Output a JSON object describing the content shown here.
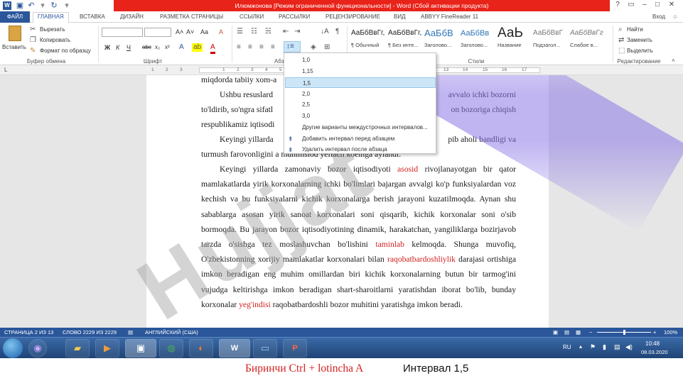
{
  "window": {
    "title": "Илюмжонова [Режим ограниченной функциональности] - Word (Сбой активации продукта)",
    "help": "?",
    "signin": "Вход"
  },
  "tabs": [
    "ФАЙЛ",
    "ГЛАВНАЯ",
    "ВСТАВКА",
    "ДИЗАЙН",
    "РАЗМЕТКА СТРАНИЦЫ",
    "ССЫЛКИ",
    "РАССЫЛКИ",
    "РЕЦЕНЗИРОВАНИЕ",
    "ВИД",
    "ABBYY FineReader 11"
  ],
  "ribbon": {
    "clipboard": {
      "paste": "Вставить",
      "cut": "Вырезать",
      "copy": "Копировать",
      "format_painter": "Формат по образцу",
      "label": "Буфер обмена"
    },
    "font": {
      "label": "Шрифт",
      "bold": "Ж",
      "italic": "К",
      "underline": "Ч",
      "strike": "abc",
      "sub": "x₂",
      "sup": "x²",
      "grow": "A˄",
      "shrink": "A˅",
      "case": "Aa",
      "clear": "A"
    },
    "paragraph": {
      "label": "Абзац"
    },
    "styles": {
      "label": "Стили",
      "items": [
        {
          "preview": "АаБбВвГг,",
          "name": "¶ Обычный"
        },
        {
          "preview": "АаБбВвГг,",
          "name": "¶ Без инте..."
        },
        {
          "preview": "АаБбВ",
          "name": "Заголово..."
        },
        {
          "preview": "АаБбВв",
          "name": "Заголово..."
        },
        {
          "preview": "АаЬ",
          "name": "Название"
        },
        {
          "preview": "АаБбВвГ",
          "name": "Подзагол..."
        },
        {
          "preview": "АаБбВвГг",
          "name": "Слабое в..."
        }
      ]
    },
    "editing": {
      "find": "Найти",
      "replace": "Заменить",
      "select": "Выделить",
      "label": "Редактирование"
    }
  },
  "ruler": {
    "numbers": [
      "1",
      "2",
      "3",
      "1",
      "2",
      "3",
      "4",
      "5",
      "6",
      "7",
      "8",
      "9",
      "10",
      "11",
      "12",
      "13",
      "14",
      "15",
      "16",
      "17"
    ]
  },
  "spacing_menu": {
    "options": [
      "1,0",
      "1,15",
      "1,5",
      "2,0",
      "2,5",
      "3,0"
    ],
    "selected": "1,5",
    "more": "Другие варианты междустрочных интервалов...",
    "add_before": "Добавить интервал перед абзацем",
    "remove_after": "Удалить интервал после абзаца"
  },
  "document": {
    "line0": "miqdorda tabiiy xom-a",
    "p1a": "Ushbu resuslard",
    "p1b": "avvalo ichki bozorni",
    "p1c": "to'ldirib, so'ngra sifatl",
    "p1d": "on bozoriga chiqish",
    "p1e": "respublikamiz iqtisodi",
    "p2a": "Keyingi yillarda",
    "p2b": "pib aholi bandligi va",
    "p2c": "turmush farovonligini",
    "p2d": "a muhimsiod yeftaсh koelnga aylandi.",
    "p3_before": "Keyingi yillarda zamonaviy bozor iqtisodiyoti ",
    "p3_red1": "asosid",
    "p3_mid1": " rivojlanayotgan bir qator mamlakatlarda yirik korxonalarning ichki bo'limlari bajargan avvalgi ko'p funksiyalardan voz kechish va bu funksiyalarni kichik korxonalarga berish jarayoni kuzatilmoqda. Aynan shu sabablarga asosan yirik sanoat korxonalari soni qisqarib, kichik korxonalar soni o'sib bormoqda. Bu jarayon bozor iqtisodiyotining dinamik, harakatchan, yangiliklarga bozirjavob tarzda o'sishga tez moslashuvchan bo'lishini ",
    "p3_red2": "taminlab",
    "p3_mid2": " kelmoqda. Shunga muvofiq, O'zbekistonning xorijiy mamlakatlar korxonalari bilan ",
    "p3_red3": "raqobatbardoshliylik",
    "p3_mid3": " darajasi ortishiga imkon beradigan eng muhim omillardan biri kichik korxonalarning butun bir tarmog'ini vujudga keltirishga imkon beradigan shart-sharoitlarni yaratishdan iborat bo'lib, bunday korxonalar ",
    "p3_red4": "yeg'indisi",
    "p3_end": " raqobatbardoshli bozor muhitini yaratishga imkon beradi.",
    "watermark": "Hujjat"
  },
  "status": {
    "page": "СТРАНИЦА 2 ИЗ 13",
    "words": "СЛОВО 2229 ИЗ 2229",
    "lang": "АНГЛИЙСКИЙ (США)",
    "zoom": "100%",
    "zoom_minus": "−",
    "zoom_plus": "+"
  },
  "taskbar": {
    "lang": "RU",
    "time": "10:48",
    "date": "08.03.2020"
  },
  "caption": {
    "left": "Биринчи Ctrl + lotincha A",
    "right": "Интервал 1,5"
  },
  "colors": {
    "word_blue": "#2b579a",
    "title_red": "#e8231a",
    "caption_red": "#d42020"
  }
}
